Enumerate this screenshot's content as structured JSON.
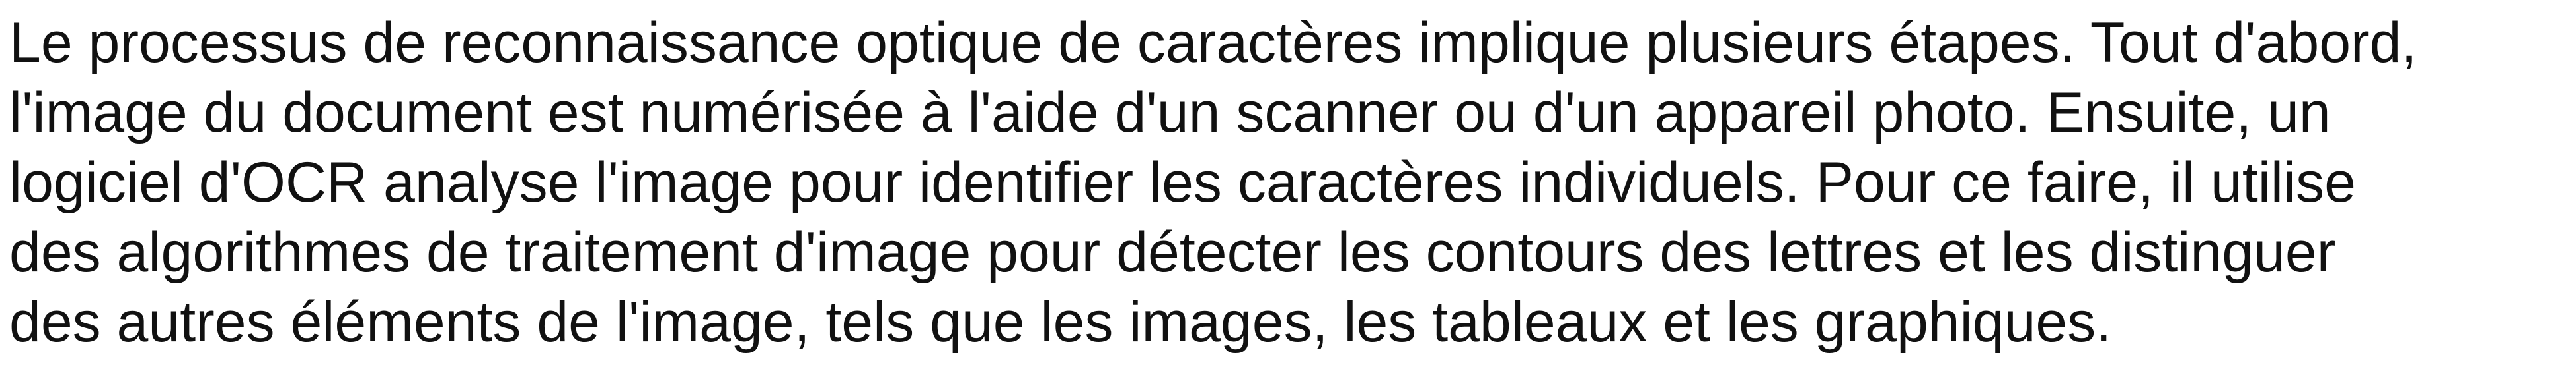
{
  "document": {
    "lines": [
      "Le processus de reconnaissance optique de caractères implique plusieurs étapes. Tout d'abord,",
      "l'image du document est numérisée à l'aide d'un scanner ou d'un appareil photo. Ensuite, un",
      "logiciel d'OCR analyse l'image pour identifier les caractères individuels. Pour ce faire, il utilise",
      "des algorithmes de traitement d'image pour détecter les contours des lettres et les distinguer",
      "des autres éléments de l'image, tels que les images, les tableaux et les graphiques."
    ]
  },
  "colors": {
    "background": "#ffffff",
    "text": "#111111"
  }
}
